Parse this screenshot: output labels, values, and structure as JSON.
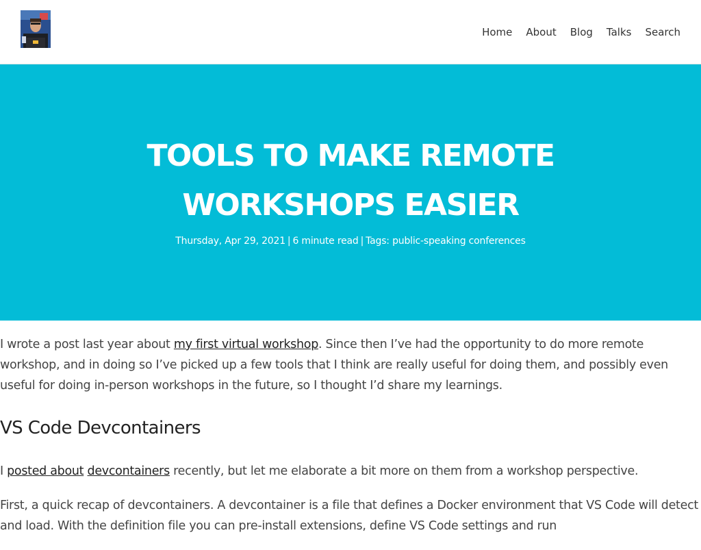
{
  "nav": {
    "avatar_alt": "Site author avatar",
    "items": [
      {
        "label": "Home"
      },
      {
        "label": "About"
      },
      {
        "label": "Blog"
      },
      {
        "label": "Talks"
      },
      {
        "label": "Search"
      }
    ]
  },
  "hero": {
    "title": "TOOLS TO MAKE REMOTE WORKSHOPS EASIER",
    "date": "Thursday, Apr 29, 2021",
    "read_time": "6 minute read",
    "tags_label": "Tags:",
    "tags": [
      "public-speaking",
      "conferences"
    ],
    "background": "#03bcd7"
  },
  "article": {
    "p1_before": "I wrote a post last year about ",
    "p1_link": "my first virtual workshop",
    "p1_after": ". Since then I’ve had the opportunity to do more remote workshop, and in doing so I’ve picked up a few tools that I think are really useful for doing them, and possibly even useful for doing in-person workshops in the future, so I thought I’d share my learnings.",
    "h2": "VS Code Devcontainers",
    "p2_before": "I ",
    "p2_link1": "posted about",
    "p2_link2": "devcontainers",
    "p2_after": " recently, but let me elaborate a bit more on them from a workshop perspective.",
    "p3": "First, a quick recap of devcontainers. A devcontainer is a file that defines a Docker environment that VS Code will detect and load. With the definition file you can pre-install extensions, define VS Code settings and run"
  }
}
